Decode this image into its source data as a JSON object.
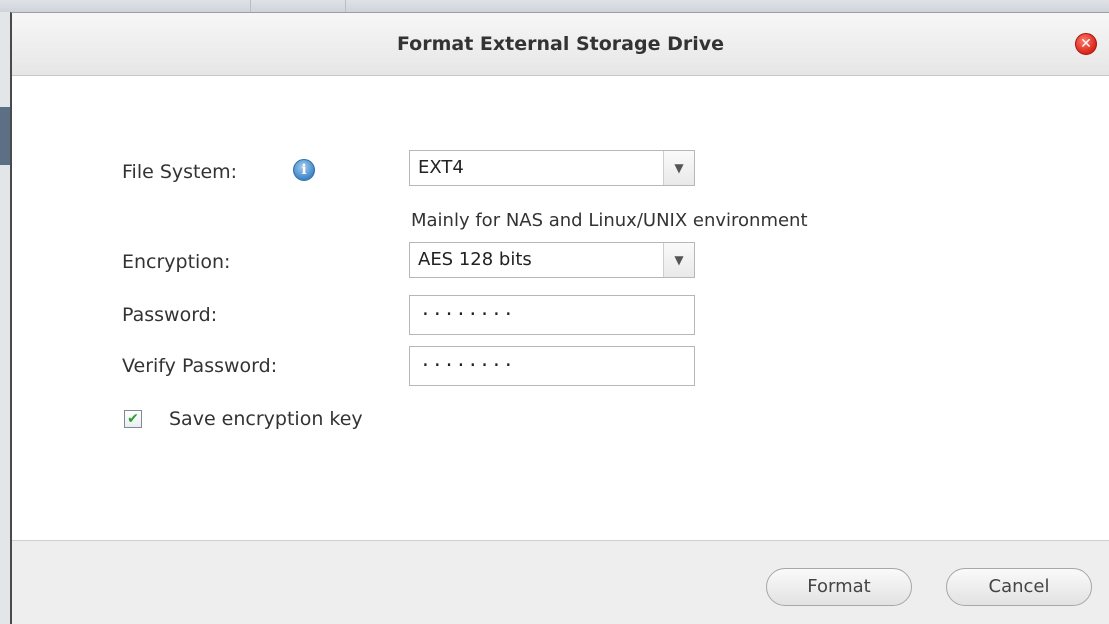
{
  "dialog": {
    "title": "Format External Storage Drive",
    "close_icon": "close-icon"
  },
  "form": {
    "file_system": {
      "label": "File System:",
      "info_icon": "info-icon",
      "info_glyph": "i",
      "selected": "EXT4",
      "hint": "Mainly for NAS and Linux/UNIX environment"
    },
    "encryption": {
      "label": "Encryption:",
      "selected": "AES 128 bits"
    },
    "password": {
      "label": "Password:",
      "value": "········"
    },
    "verify_password": {
      "label": "Verify Password:",
      "value": "········"
    },
    "save_key": {
      "label": "Save encryption key",
      "checked": true
    }
  },
  "footer": {
    "format_label": "Format",
    "cancel_label": "Cancel"
  },
  "colors": {
    "close_button": "#d9251a",
    "info_icon": "#3f86c8",
    "checkmark": "#2e9c2e"
  }
}
